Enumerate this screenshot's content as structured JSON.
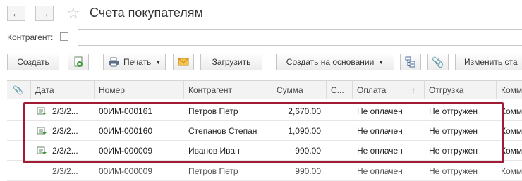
{
  "nav": {
    "back_label": "←",
    "forward_label": "→"
  },
  "page": {
    "title": "Счета покупателям"
  },
  "filter": {
    "label": "Контрагент:"
  },
  "toolbar": {
    "create": "Создать",
    "print": "Печать",
    "upload": "Загрузить",
    "create_based_on": "Создать на основании",
    "change_status": "Изменить ста"
  },
  "columns": {
    "date": "Дата",
    "number": "Номер",
    "counterparty": "Контрагент",
    "amount": "Сумма",
    "currency": "С...",
    "payment": "Оплата",
    "sort_indicator": "↑",
    "shipment": "Отгрузка",
    "comment": "Комм"
  },
  "rows": [
    {
      "date": "2/3/2...",
      "number": "00ИМ-000161",
      "counterparty": "Петров Петр",
      "amount": "2,670.00",
      "payment": "Не оплачен",
      "shipment": "Не отгружен",
      "comment": "Комм"
    },
    {
      "date": "2/3/2...",
      "number": "00ИМ-000160",
      "counterparty": "Степанов Степан",
      "amount": "1,090.00",
      "payment": "Не оплачен",
      "shipment": "Не отгружен",
      "comment": "Комм"
    },
    {
      "date": "2/3/2...",
      "number": "00ИМ-000009",
      "counterparty": "Иванов Иван",
      "amount": "990.00",
      "payment": "Не оплачен",
      "shipment": "Не отгружен",
      "comment": "Комм"
    }
  ],
  "partial_row": {
    "date": "2/3/2...",
    "number": "00ИМ-000009",
    "counterparty": "Петров Петр",
    "amount": "990.00",
    "payment": "Не оплачен",
    "shipment": "Не отгружен",
    "comment": "Комм"
  },
  "colors": {
    "highlight": "#a01c35",
    "header_bg": "#f3f3f3",
    "row_icon": "#3a9a3a"
  }
}
